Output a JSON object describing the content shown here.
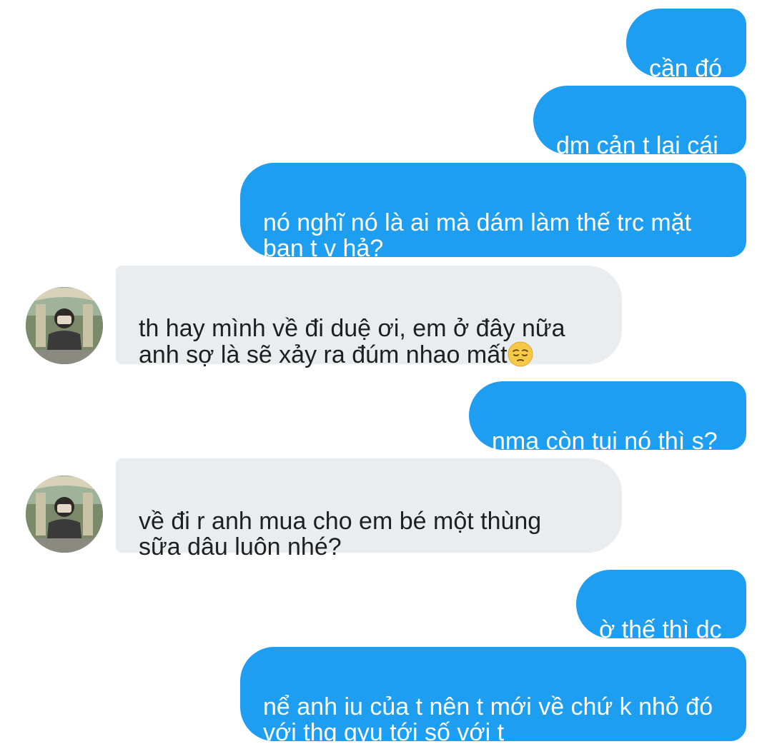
{
  "conversation": {
    "messages": [
      {
        "side": "out",
        "text": "cần đó"
      },
      {
        "side": "out",
        "text": "dm cản t lại cái"
      },
      {
        "side": "out",
        "text": "nó nghĩ nó là ai mà dám làm thế trc mặt\nbạn t v hả?"
      },
      {
        "side": "in",
        "text": "th hay mình về đi duệ ơi, em ở đây nữa\nanh sợ là sẽ xảy ra đúm nhao mất",
        "emoji": "pensive-face-icon"
      },
      {
        "side": "out",
        "text": "nma còn tụi nó thì s?"
      },
      {
        "side": "in",
        "text": "về đi r anh mua cho em bé một thùng\nsữa dâu luôn nhé?"
      },
      {
        "side": "out",
        "text": "ờ thế thì dc"
      },
      {
        "side": "out",
        "text": "nể anh iu của t nên t mới về chứ k nhỏ đó\nvới thg gyu tới số với t"
      }
    ]
  },
  "colors": {
    "outgoing_bubble": "#1e9ef0",
    "incoming_bubble": "#e9edf0",
    "outgoing_text": "#ffffff",
    "incoming_text": "#1f1f1f"
  }
}
